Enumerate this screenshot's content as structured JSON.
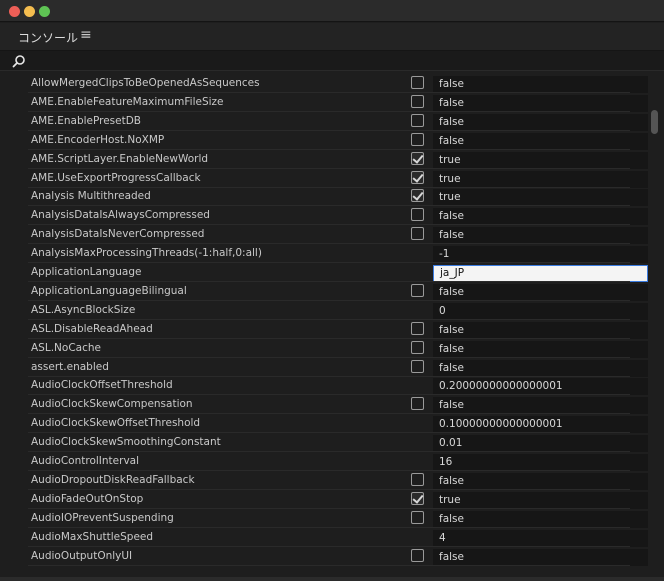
{
  "panel": {
    "title": "コンソール",
    "menu_glyph": "≡"
  },
  "search": {
    "value": "",
    "placeholder": ""
  },
  "rows": [
    {
      "name": "AllowMergedClipsToBeOpenedAsSequences",
      "type": "bool",
      "checked": false,
      "value": "false"
    },
    {
      "name": "AME.EnableFeatureMaximumFileSize",
      "type": "bool",
      "checked": false,
      "value": "false"
    },
    {
      "name": "AME.EnablePresetDB",
      "type": "bool",
      "checked": false,
      "value": "false"
    },
    {
      "name": "AME.EncoderHost.NoXMP",
      "type": "bool",
      "checked": false,
      "value": "false"
    },
    {
      "name": "AME.ScriptLayer.EnableNewWorld",
      "type": "bool",
      "checked": true,
      "value": "true"
    },
    {
      "name": "AME.UseExportProgressCallback",
      "type": "bool",
      "checked": true,
      "value": "true"
    },
    {
      "name": "Analysis Multithreaded",
      "type": "bool",
      "checked": true,
      "value": "true"
    },
    {
      "name": "AnalysisDataIsAlwaysCompressed",
      "type": "bool",
      "checked": false,
      "value": "false"
    },
    {
      "name": "AnalysisDataIsNeverCompressed",
      "type": "bool",
      "checked": false,
      "value": "false"
    },
    {
      "name": "AnalysisMaxProcessingThreads(-1:half,0:all)",
      "type": "text",
      "value": "-1"
    },
    {
      "name": "ApplicationLanguage",
      "type": "text",
      "value": "ja_JP",
      "editing": true
    },
    {
      "name": "ApplicationLanguageBilingual",
      "type": "bool",
      "checked": false,
      "value": "false"
    },
    {
      "name": "ASL.AsyncBlockSize",
      "type": "text",
      "value": "0"
    },
    {
      "name": "ASL.DisableReadAhead",
      "type": "bool",
      "checked": false,
      "value": "false"
    },
    {
      "name": "ASL.NoCache",
      "type": "bool",
      "checked": false,
      "value": "false"
    },
    {
      "name": "assert.enabled",
      "type": "bool",
      "checked": false,
      "value": "false"
    },
    {
      "name": "AudioClockOffsetThreshold",
      "type": "text",
      "value": "0.20000000000000001"
    },
    {
      "name": "AudioClockSkewCompensation",
      "type": "bool",
      "checked": false,
      "value": "false"
    },
    {
      "name": "AudioClockSkewOffsetThreshold",
      "type": "text",
      "value": "0.10000000000000001"
    },
    {
      "name": "AudioClockSkewSmoothingConstant",
      "type": "text",
      "value": "0.01"
    },
    {
      "name": "AudioControlInterval",
      "type": "text",
      "value": "16"
    },
    {
      "name": "AudioDropoutDiskReadFallback",
      "type": "bool",
      "checked": false,
      "value": "false"
    },
    {
      "name": "AudioFadeOutOnStop",
      "type": "bool",
      "checked": true,
      "value": "true"
    },
    {
      "name": "AudioIOPreventSuspending",
      "type": "bool",
      "checked": false,
      "value": "false"
    },
    {
      "name": "AudioMaxShuttleSpeed",
      "type": "text",
      "value": "4"
    },
    {
      "name": "AudioOutputOnlyUI",
      "type": "bool",
      "checked": false,
      "value": "false"
    }
  ]
}
